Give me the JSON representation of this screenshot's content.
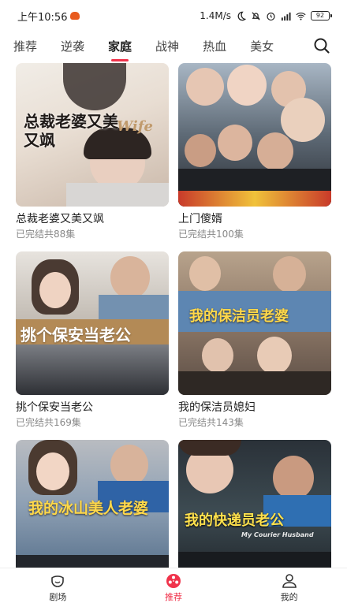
{
  "status_bar": {
    "time": "上午10:56",
    "network_speed": "1.4M/s",
    "battery": "92"
  },
  "tabs": [
    {
      "label": "推荐",
      "active": false
    },
    {
      "label": "逆袭",
      "active": false
    },
    {
      "label": "家庭",
      "active": true
    },
    {
      "label": "战神",
      "active": false
    },
    {
      "label": "热血",
      "active": false
    },
    {
      "label": "美女",
      "active": false
    }
  ],
  "dramas": [
    {
      "title": "总裁老婆又美又飒",
      "status": "已完结共88集",
      "poster_text": "总裁老婆又美又飒",
      "poster_text_sub": "Wife"
    },
    {
      "title": "上门傻婿",
      "status": "已完结共100集",
      "poster_text": "",
      "poster_text_sub": ""
    },
    {
      "title": "挑个保安当老公",
      "status": "已完结共169集",
      "poster_text": "挑个保安当老公",
      "poster_text_sub": ""
    },
    {
      "title": "我的保洁员媳妇",
      "status": "已完结共143集",
      "poster_text": "我的保洁员老婆",
      "poster_text_sub": ""
    },
    {
      "title": "",
      "status": "",
      "poster_text": "我的冰山美人老婆",
      "poster_text_sub": ""
    },
    {
      "title": "",
      "status": "",
      "poster_text": "我的快递员老公",
      "poster_text_sub": "My Courier Husband"
    }
  ],
  "bottom_nav": [
    {
      "label": "剧场",
      "active": false
    },
    {
      "label": "推荐",
      "active": true
    },
    {
      "label": "我的",
      "active": false
    }
  ],
  "colors": {
    "accent": "#f0334b",
    "subtext": "#888888"
  }
}
